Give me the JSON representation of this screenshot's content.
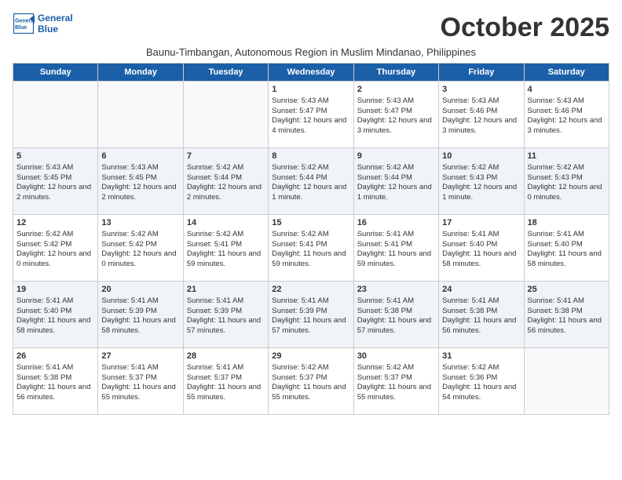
{
  "header": {
    "logo_line1": "General",
    "logo_line2": "Blue",
    "month_title": "October 2025",
    "subtitle": "Baunu-Timbangan, Autonomous Region in Muslim Mindanao, Philippines"
  },
  "days_of_week": [
    "Sunday",
    "Monday",
    "Tuesday",
    "Wednesday",
    "Thursday",
    "Friday",
    "Saturday"
  ],
  "weeks": [
    {
      "shade": "white",
      "days": [
        {
          "number": "",
          "empty": true
        },
        {
          "number": "",
          "empty": true
        },
        {
          "number": "",
          "empty": true
        },
        {
          "number": "1",
          "sunrise": "Sunrise: 5:43 AM",
          "sunset": "Sunset: 5:47 PM",
          "daylight": "Daylight: 12 hours and 4 minutes."
        },
        {
          "number": "2",
          "sunrise": "Sunrise: 5:43 AM",
          "sunset": "Sunset: 5:47 PM",
          "daylight": "Daylight: 12 hours and 3 minutes."
        },
        {
          "number": "3",
          "sunrise": "Sunrise: 5:43 AM",
          "sunset": "Sunset: 5:46 PM",
          "daylight": "Daylight: 12 hours and 3 minutes."
        },
        {
          "number": "4",
          "sunrise": "Sunrise: 5:43 AM",
          "sunset": "Sunset: 5:46 PM",
          "daylight": "Daylight: 12 hours and 3 minutes."
        }
      ]
    },
    {
      "shade": "shaded",
      "days": [
        {
          "number": "5",
          "sunrise": "Sunrise: 5:43 AM",
          "sunset": "Sunset: 5:45 PM",
          "daylight": "Daylight: 12 hours and 2 minutes."
        },
        {
          "number": "6",
          "sunrise": "Sunrise: 5:43 AM",
          "sunset": "Sunset: 5:45 PM",
          "daylight": "Daylight: 12 hours and 2 minutes."
        },
        {
          "number": "7",
          "sunrise": "Sunrise: 5:42 AM",
          "sunset": "Sunset: 5:44 PM",
          "daylight": "Daylight: 12 hours and 2 minutes."
        },
        {
          "number": "8",
          "sunrise": "Sunrise: 5:42 AM",
          "sunset": "Sunset: 5:44 PM",
          "daylight": "Daylight: 12 hours and 1 minute."
        },
        {
          "number": "9",
          "sunrise": "Sunrise: 5:42 AM",
          "sunset": "Sunset: 5:44 PM",
          "daylight": "Daylight: 12 hours and 1 minute."
        },
        {
          "number": "10",
          "sunrise": "Sunrise: 5:42 AM",
          "sunset": "Sunset: 5:43 PM",
          "daylight": "Daylight: 12 hours and 1 minute."
        },
        {
          "number": "11",
          "sunrise": "Sunrise: 5:42 AM",
          "sunset": "Sunset: 5:43 PM",
          "daylight": "Daylight: 12 hours and 0 minutes."
        }
      ]
    },
    {
      "shade": "white",
      "days": [
        {
          "number": "12",
          "sunrise": "Sunrise: 5:42 AM",
          "sunset": "Sunset: 5:42 PM",
          "daylight": "Daylight: 12 hours and 0 minutes."
        },
        {
          "number": "13",
          "sunrise": "Sunrise: 5:42 AM",
          "sunset": "Sunset: 5:42 PM",
          "daylight": "Daylight: 12 hours and 0 minutes."
        },
        {
          "number": "14",
          "sunrise": "Sunrise: 5:42 AM",
          "sunset": "Sunset: 5:41 PM",
          "daylight": "Daylight: 11 hours and 59 minutes."
        },
        {
          "number": "15",
          "sunrise": "Sunrise: 5:42 AM",
          "sunset": "Sunset: 5:41 PM",
          "daylight": "Daylight: 11 hours and 59 minutes."
        },
        {
          "number": "16",
          "sunrise": "Sunrise: 5:41 AM",
          "sunset": "Sunset: 5:41 PM",
          "daylight": "Daylight: 11 hours and 59 minutes."
        },
        {
          "number": "17",
          "sunrise": "Sunrise: 5:41 AM",
          "sunset": "Sunset: 5:40 PM",
          "daylight": "Daylight: 11 hours and 58 minutes."
        },
        {
          "number": "18",
          "sunrise": "Sunrise: 5:41 AM",
          "sunset": "Sunset: 5:40 PM",
          "daylight": "Daylight: 11 hours and 58 minutes."
        }
      ]
    },
    {
      "shade": "shaded",
      "days": [
        {
          "number": "19",
          "sunrise": "Sunrise: 5:41 AM",
          "sunset": "Sunset: 5:40 PM",
          "daylight": "Daylight: 11 hours and 58 minutes."
        },
        {
          "number": "20",
          "sunrise": "Sunrise: 5:41 AM",
          "sunset": "Sunset: 5:39 PM",
          "daylight": "Daylight: 11 hours and 58 minutes."
        },
        {
          "number": "21",
          "sunrise": "Sunrise: 5:41 AM",
          "sunset": "Sunset: 5:39 PM",
          "daylight": "Daylight: 11 hours and 57 minutes."
        },
        {
          "number": "22",
          "sunrise": "Sunrise: 5:41 AM",
          "sunset": "Sunset: 5:39 PM",
          "daylight": "Daylight: 11 hours and 57 minutes."
        },
        {
          "number": "23",
          "sunrise": "Sunrise: 5:41 AM",
          "sunset": "Sunset: 5:38 PM",
          "daylight": "Daylight: 11 hours and 57 minutes."
        },
        {
          "number": "24",
          "sunrise": "Sunrise: 5:41 AM",
          "sunset": "Sunset: 5:38 PM",
          "daylight": "Daylight: 11 hours and 56 minutes."
        },
        {
          "number": "25",
          "sunrise": "Sunrise: 5:41 AM",
          "sunset": "Sunset: 5:38 PM",
          "daylight": "Daylight: 11 hours and 56 minutes."
        }
      ]
    },
    {
      "shade": "white",
      "days": [
        {
          "number": "26",
          "sunrise": "Sunrise: 5:41 AM",
          "sunset": "Sunset: 5:38 PM",
          "daylight": "Daylight: 11 hours and 56 minutes."
        },
        {
          "number": "27",
          "sunrise": "Sunrise: 5:41 AM",
          "sunset": "Sunset: 5:37 PM",
          "daylight": "Daylight: 11 hours and 55 minutes."
        },
        {
          "number": "28",
          "sunrise": "Sunrise: 5:41 AM",
          "sunset": "Sunset: 5:37 PM",
          "daylight": "Daylight: 11 hours and 55 minutes."
        },
        {
          "number": "29",
          "sunrise": "Sunrise: 5:42 AM",
          "sunset": "Sunset: 5:37 PM",
          "daylight": "Daylight: 11 hours and 55 minutes."
        },
        {
          "number": "30",
          "sunrise": "Sunrise: 5:42 AM",
          "sunset": "Sunset: 5:37 PM",
          "daylight": "Daylight: 11 hours and 55 minutes."
        },
        {
          "number": "31",
          "sunrise": "Sunrise: 5:42 AM",
          "sunset": "Sunset: 5:36 PM",
          "daylight": "Daylight: 11 hours and 54 minutes."
        },
        {
          "number": "",
          "empty": true
        }
      ]
    }
  ]
}
